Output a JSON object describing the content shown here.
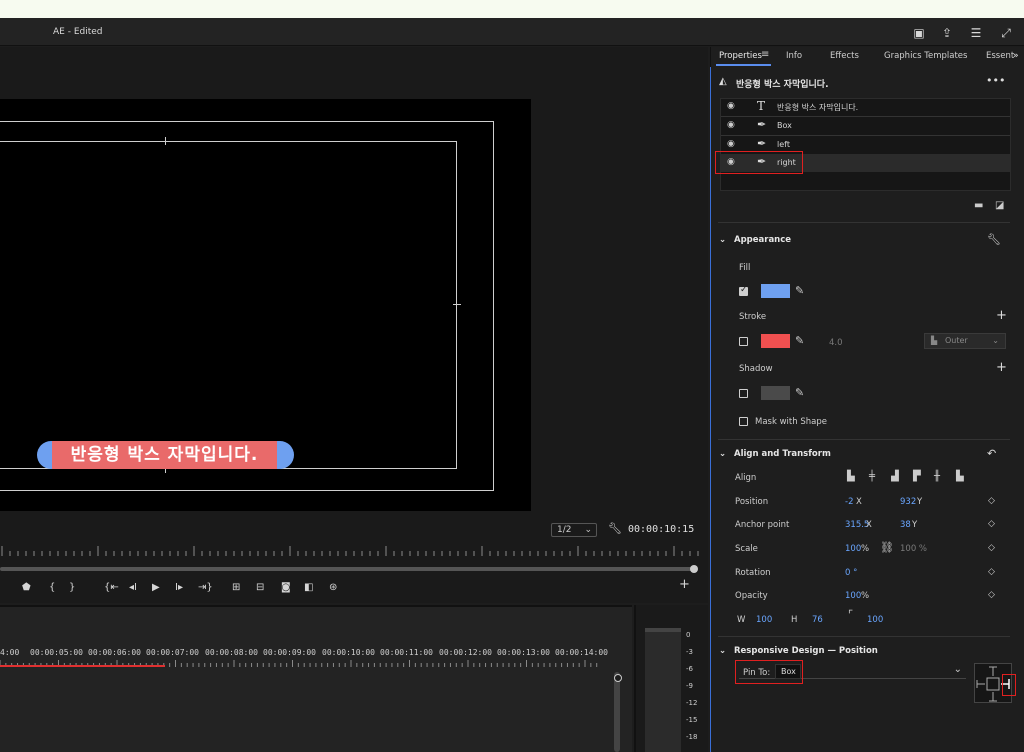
{
  "window": {
    "title": "AE - Edited"
  },
  "caption": {
    "text": "반응형 박스 자막입니다."
  },
  "monitor": {
    "zoom": "1/2",
    "timecode": "00:00:10:15"
  },
  "timeline": {
    "labels": [
      "4:00",
      "00:00:05:00",
      "00:00:06:00",
      "00:00:07:00",
      "00:00:08:00",
      "00:00:09:00",
      "00:00:10:00",
      "00:00:11:00",
      "00:00:12:00",
      "00:00:13:00",
      "00:00:14:00"
    ]
  },
  "meter": {
    "labels": [
      "0",
      "-3",
      "-6",
      "-9",
      "-12",
      "-15",
      "-18"
    ]
  },
  "panel": {
    "tabs": [
      "Properties",
      "Info",
      "Effects",
      "Graphics Templates",
      "Essent"
    ],
    "header": "반응형 박스 자막입니다.",
    "layers": [
      {
        "name": "반응형 박스 자막입니다.",
        "icon": "text-icon"
      },
      {
        "name": "Box",
        "icon": "pen-icon"
      },
      {
        "name": "left",
        "icon": "pen-icon"
      },
      {
        "name": "right",
        "icon": "pen-icon"
      }
    ],
    "appearance": {
      "title": "Appearance",
      "fill_label": "Fill",
      "fill_color": "#6ea0f0",
      "stroke_label": "Stroke",
      "stroke_color": "#f05050",
      "stroke_width": "4.0",
      "stroke_position": "Outer",
      "shadow_label": "Shadow",
      "shadow_color": "#4a4a4a",
      "mask_label": "Mask with Shape"
    },
    "transform": {
      "title": "Align and Transform",
      "align_label": "Align",
      "position_label": "Position",
      "pos_x": "-2",
      "pos_x_unit": "X",
      "pos_y": "932",
      "pos_y_unit": "Y",
      "anchor_label": "Anchor point",
      "anc_x": "315.5",
      "anc_x_unit": "X",
      "anc_y": "38",
      "anc_y_unit": "Y",
      "scale_label": "Scale",
      "scale_val": "100",
      "scale_unit": "%",
      "scale_val2": "100 %",
      "rotation_label": "Rotation",
      "rotation_val": "0 °",
      "opacity_label": "Opacity",
      "opacity_val": "100",
      "opacity_unit": "%",
      "w_label": "W",
      "w_val": "100",
      "h_label": "H",
      "h_val": "76",
      "corner_val": "100"
    },
    "responsive": {
      "title": "Responsive Design — Position",
      "pin_label": "Pin To:",
      "pin_value": "Box"
    }
  }
}
